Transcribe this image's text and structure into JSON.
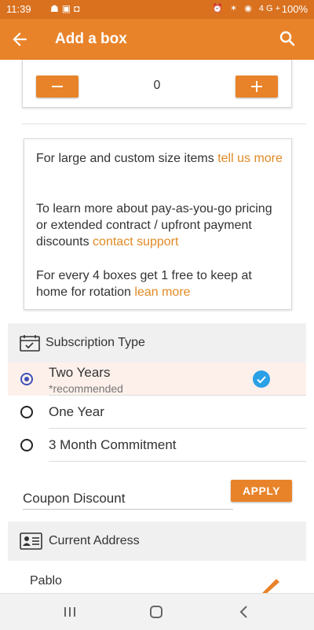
{
  "status_bar": {
    "time": "11:39",
    "battery": "100%",
    "signal_label": "4G+"
  },
  "app_bar": {
    "title": "Add a box"
  },
  "quantity": {
    "value": "0"
  },
  "info": {
    "p1_text": "For large and custom size items ",
    "p1_link": "tell us more",
    "p2_text": "To learn more about pay-as-you-go pricing or extended contract / upfront payment discounts ",
    "p2_link": "contact support",
    "p3_text": "For every 4 boxes get 1 free to keep at home for rotation ",
    "p3_link": "lean more"
  },
  "subscription": {
    "header": "Subscription Type",
    "options": [
      {
        "label": "Two Years",
        "sublabel": "*recommended",
        "selected": true
      },
      {
        "label": "One Year",
        "selected": false
      },
      {
        "label": "3 Month Commitment",
        "selected": false
      }
    ]
  },
  "coupon": {
    "label": "Coupon Discount",
    "apply_label": "APPLY"
  },
  "address": {
    "header": "Current Address",
    "name": "Pablo"
  },
  "colors": {
    "primary": "#e8832a",
    "status_bar": "#d9711f",
    "link": "#e08a24",
    "radio": "#3f51b5",
    "check": "#2aa0e6"
  },
  "icons": [
    "back-arrow-icon",
    "search-icon",
    "minus-icon",
    "plus-icon",
    "calendar-check-icon",
    "check-circle-icon",
    "id-card-icon",
    "edit-pencil-icon",
    "recents-icon",
    "home-icon",
    "back-icon"
  ]
}
